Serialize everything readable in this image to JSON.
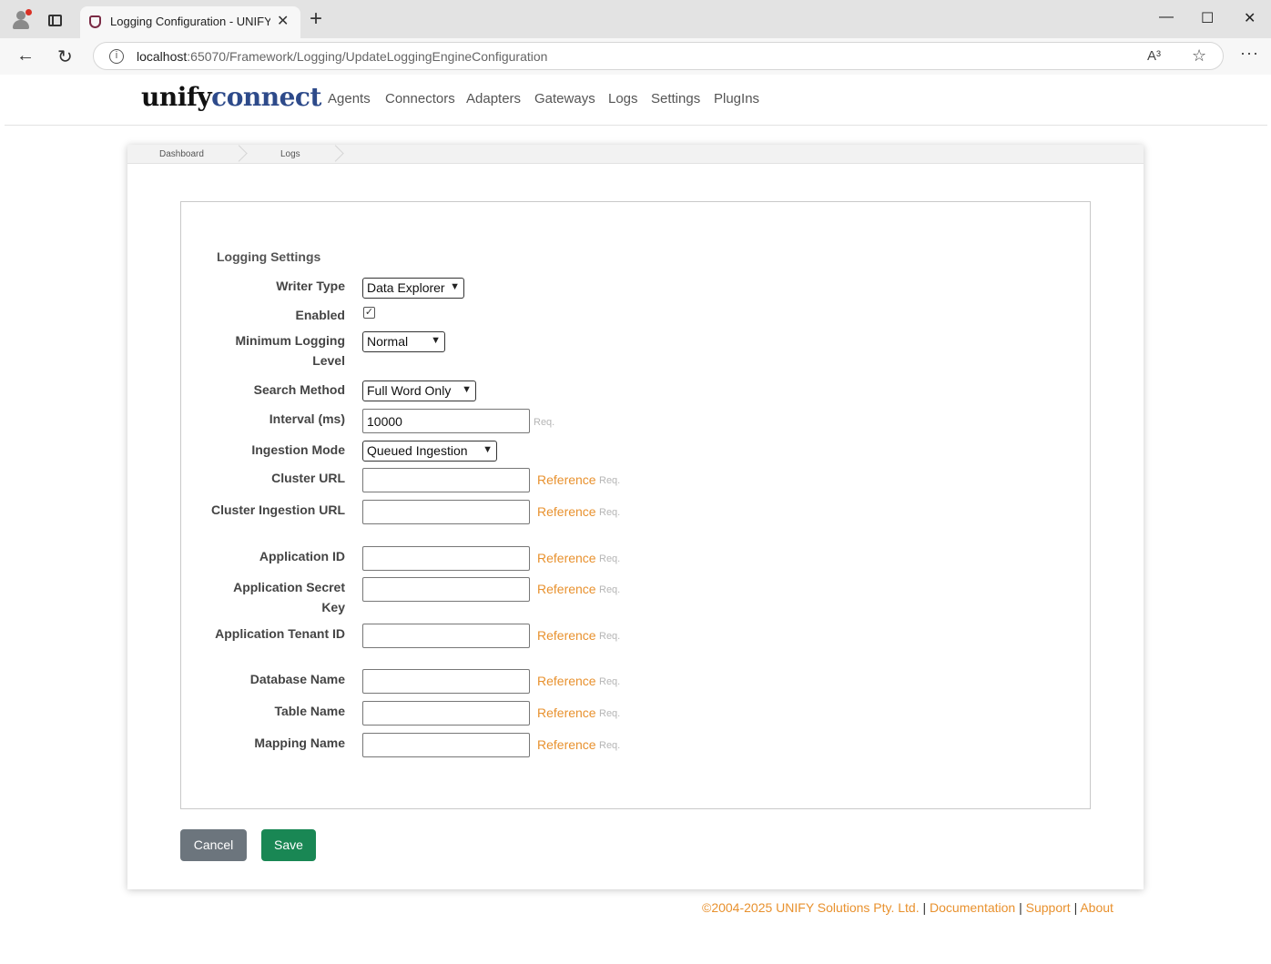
{
  "browser": {
    "tab_title": "Logging Configuration - UNIFYConnect",
    "url_host": "localhost",
    "url_rest": ":65070/Framework/Logging/UpdateLoggingEngineConfiguration",
    "read_aloud": "A³"
  },
  "header": {
    "logo_part1": "unify",
    "logo_part2": "connect",
    "menu": [
      "Agents",
      "Connectors",
      "Adapters",
      "Gateways",
      "Logs",
      "Settings",
      "PlugIns"
    ]
  },
  "breadcrumb": [
    "Dashboard",
    "Logs"
  ],
  "form": {
    "section_title": "Logging Settings",
    "fields": {
      "writer_type": {
        "label": "Writer Type",
        "value": "Data Explorer"
      },
      "enabled": {
        "label": "Enabled",
        "checked": true
      },
      "min_level": {
        "label": "Minimum Logging Level",
        "value": "Normal"
      },
      "search_method": {
        "label": "Search Method",
        "value": "Full Word Only"
      },
      "interval": {
        "label": "Interval (ms)",
        "value": "10000"
      },
      "ingestion_mode": {
        "label": "Ingestion Mode",
        "value": "Queued Ingestion"
      },
      "cluster_url": {
        "label": "Cluster URL",
        "value": ""
      },
      "cluster_ingestion_url": {
        "label": "Cluster Ingestion URL",
        "value": ""
      },
      "application_id": {
        "label": "Application ID",
        "value": ""
      },
      "application_secret_key": {
        "label": "Application Secret Key",
        "value": ""
      },
      "application_tenant_id": {
        "label": "Application Tenant ID",
        "value": ""
      },
      "database_name": {
        "label": "Database Name",
        "value": ""
      },
      "table_name": {
        "label": "Table Name",
        "value": ""
      },
      "mapping_name": {
        "label": "Mapping Name",
        "value": ""
      }
    },
    "reference_label": "Reference",
    "required_label": "Req.",
    "cancel_label": "Cancel",
    "save_label": "Save"
  },
  "footer": {
    "copyright": "©2004-2025 UNIFY Solutions Pty. Ltd.",
    "separator": "|",
    "documentation": "Documentation",
    "support": "Support",
    "about": "About"
  },
  "colors": {
    "accent_orange": "#e8912e",
    "save_green": "#198754",
    "cancel_gray": "#6c757d",
    "logo_blue": "#2d4a8a"
  }
}
